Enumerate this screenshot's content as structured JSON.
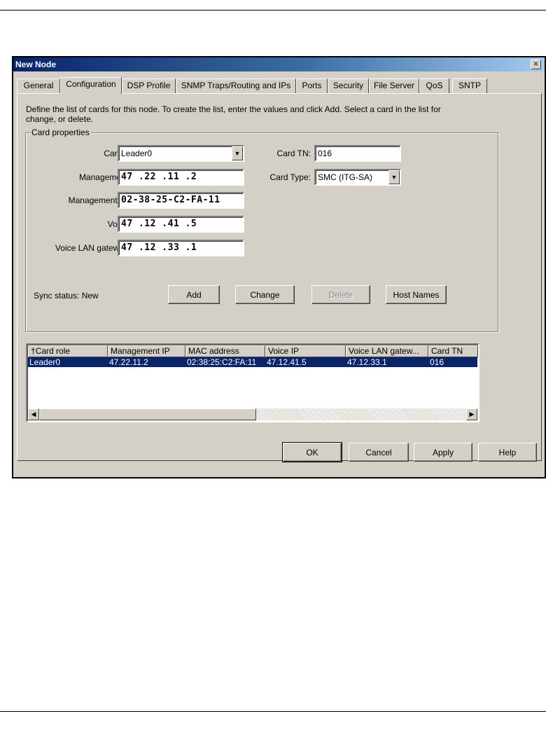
{
  "window": {
    "title": "New Node",
    "close_glyph": "×"
  },
  "tabs": [
    {
      "label": "General"
    },
    {
      "label": "Configuration",
      "active": true
    },
    {
      "label": "DSP Profile"
    },
    {
      "label": "SNMP Traps/Routing and IPs"
    },
    {
      "label": "Ports"
    },
    {
      "label": "Security"
    },
    {
      "label": "File Server"
    },
    {
      "label": "QoS"
    },
    {
      "label": "SNTP"
    }
  ],
  "intro_text": "Define the list of cards for this node.  To create the list, enter the values and click Add.  Select a card in the list for change, or delete.",
  "card_properties": {
    "legend": "Card properties",
    "card_role_label": "Card role:",
    "card_role_value": "Leader0",
    "mgmt_ip_label": "Management IP:",
    "mgmt_ip_value": "47 .22 .11 .2",
    "mgmt_mac_label": "Management MAC:",
    "mgmt_mac_value": "02-38-25-C2-FA-11",
    "voice_ip_label": "Voice IP:",
    "voice_ip_value": "47 .12 .41 .5",
    "voice_gw_label": "Voice LAN gateway IP:",
    "voice_gw_value": "47 .12 .33 .1",
    "card_tn_label": "Card TN:",
    "card_tn_value": "016",
    "card_type_label": "Card Type:",
    "card_type_value": "SMC (ITG-SA)",
    "sync_status": "Sync status:  New"
  },
  "action_buttons": {
    "add": "Add",
    "change": "Change",
    "delete": "Delete",
    "host_names": "Host Names"
  },
  "list": {
    "columns": [
      "Card role",
      "Management IP",
      "MAC address",
      "Voice IP",
      "Voice LAN gatew...",
      "Card TN"
    ],
    "sort_glyph": "†",
    "rows": [
      [
        "Leader0",
        "47.22.11.2",
        "02:38:25:C2:FA:11",
        "47.12.41.5",
        "47.12.33.1",
        "016"
      ]
    ]
  },
  "dialog_buttons": {
    "ok": "OK",
    "cancel": "Cancel",
    "apply": "Apply",
    "help": "Help"
  },
  "icons": {
    "dropdown": "▼",
    "scroll_left": "◀",
    "scroll_right": "▶"
  }
}
